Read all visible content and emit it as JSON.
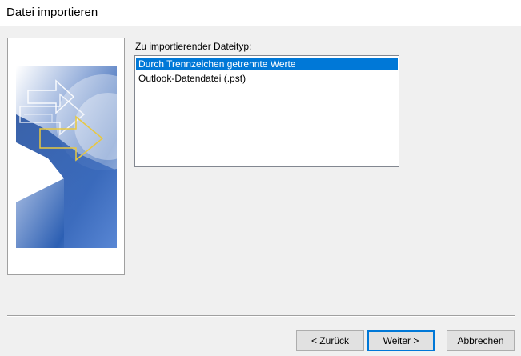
{
  "window": {
    "title": "Datei importieren"
  },
  "import": {
    "label": "Zu importierender Dateityp:",
    "items": [
      {
        "label": "Durch Trennzeichen getrennte Werte",
        "selected": true
      },
      {
        "label": "Outlook-Datendatei (.pst)",
        "selected": false
      }
    ]
  },
  "buttons": {
    "back": "< Zurück",
    "next": "Weiter >",
    "cancel": "Abbrechen"
  },
  "colors": {
    "selection": "#0078d7",
    "wizard_blue": "#2a5db0",
    "arrow_highlight": "#e8c840"
  },
  "icons": {
    "wizard_graphic": "import-arrows-graphic"
  }
}
